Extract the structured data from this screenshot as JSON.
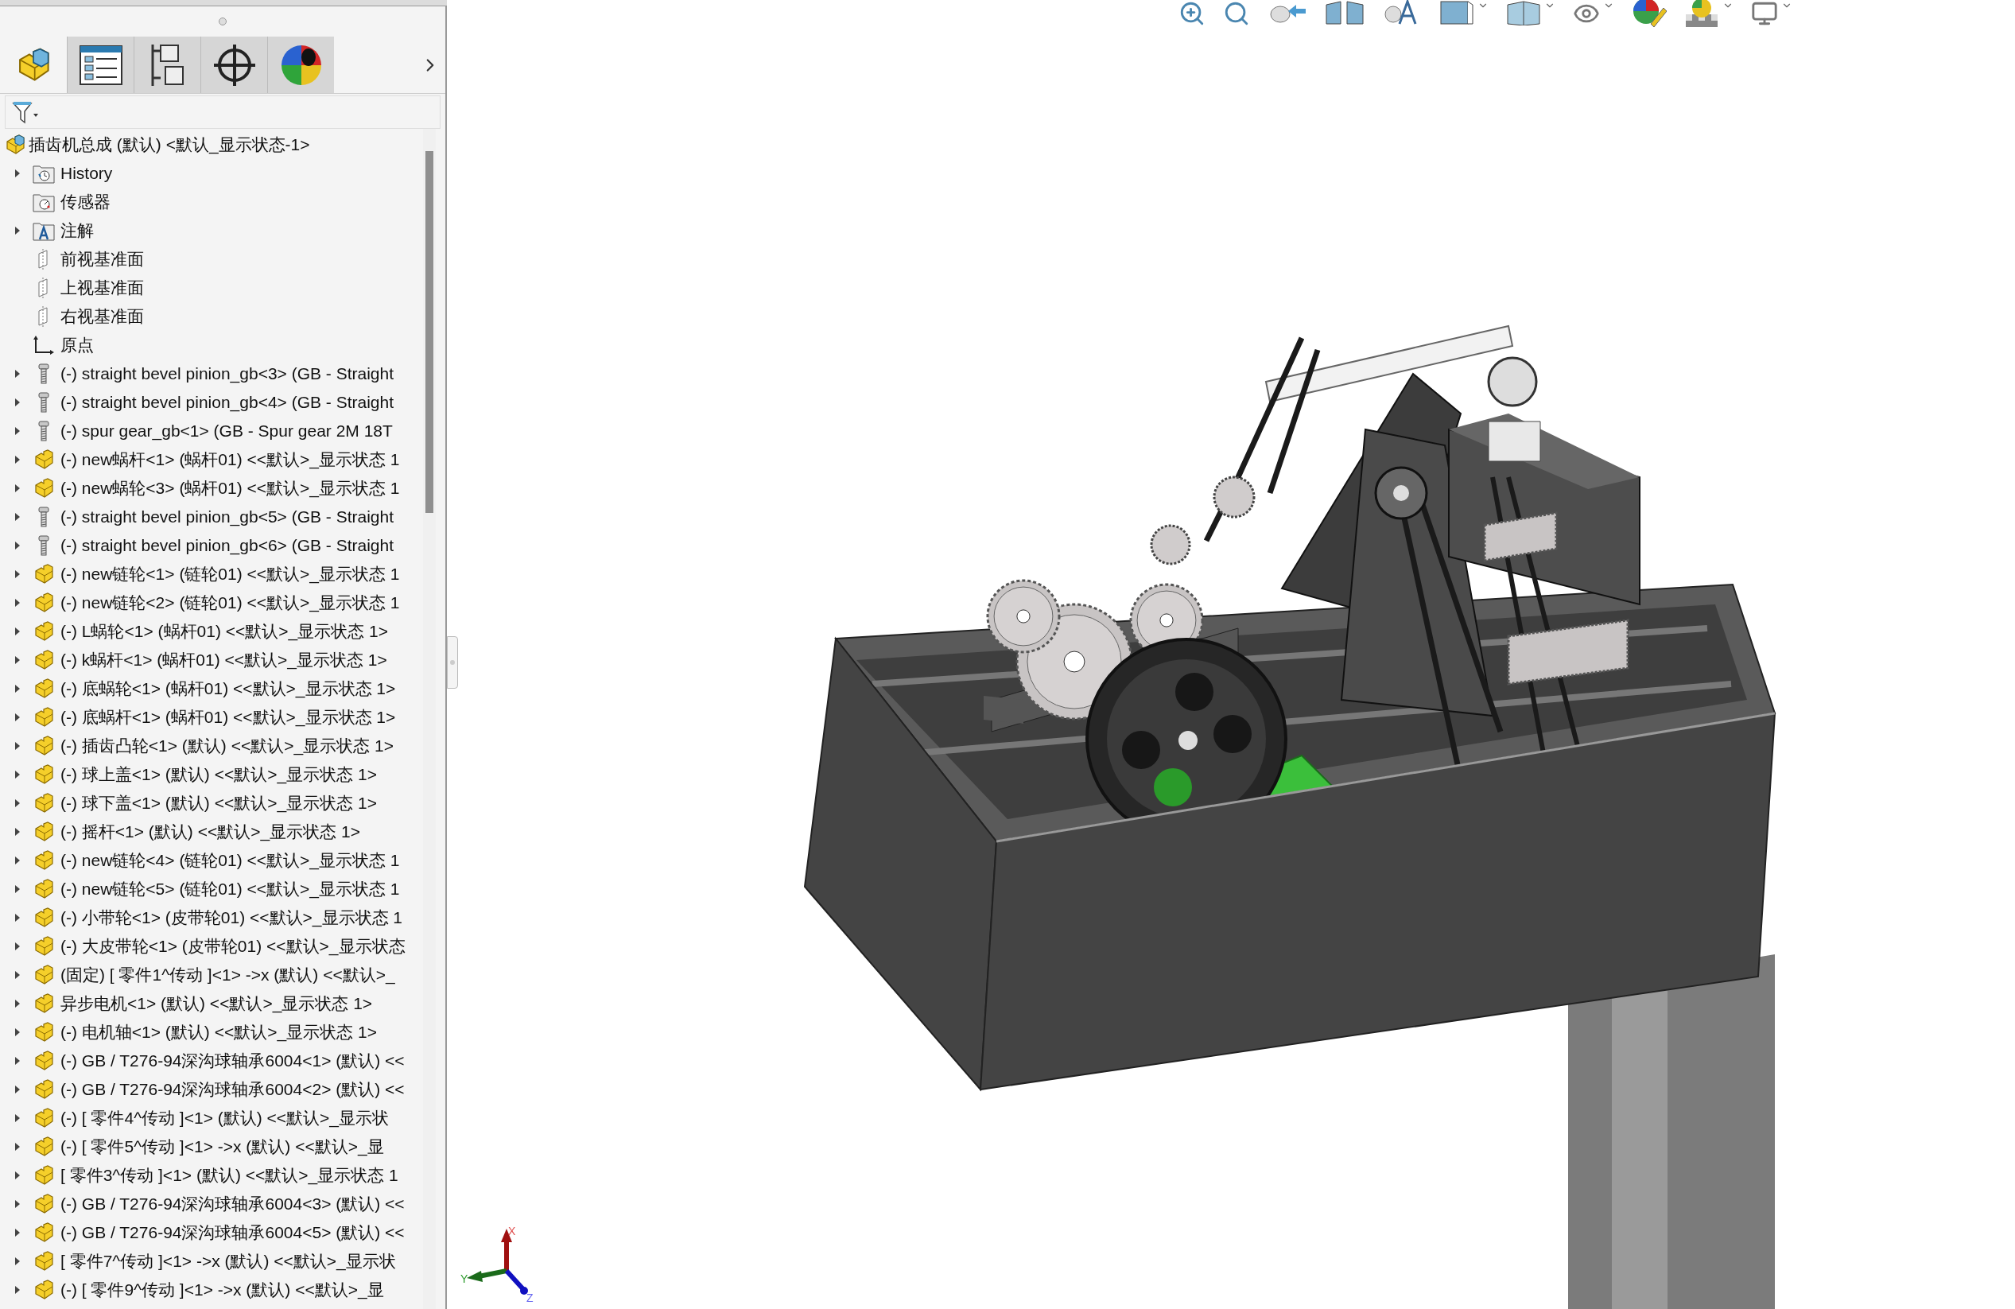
{
  "panel_tabs": [
    {
      "kind": "feature-manager",
      "selected": true
    },
    {
      "kind": "property-manager",
      "selected": false
    },
    {
      "kind": "configuration-manager",
      "selected": false
    },
    {
      "kind": "dimxpert",
      "selected": false
    },
    {
      "kind": "display-manager",
      "selected": false
    }
  ],
  "tree": {
    "label": "插齿机总成 (默认) <默认_显示状态-1>",
    "children": [
      {
        "kind": "history",
        "expandable": true,
        "label": "History"
      },
      {
        "kind": "sensor",
        "expandable": false,
        "label": "传感器"
      },
      {
        "kind": "annotation",
        "expandable": true,
        "label": "注解"
      },
      {
        "kind": "plane",
        "expandable": false,
        "label": "前视基准面"
      },
      {
        "kind": "plane",
        "expandable": false,
        "label": "上视基准面"
      },
      {
        "kind": "plane",
        "expandable": false,
        "label": "右视基准面"
      },
      {
        "kind": "origin",
        "expandable": false,
        "label": "原点"
      },
      {
        "kind": "toolbox",
        "expandable": true,
        "label": "(-) straight bevel pinion_gb<3> (GB - Straight"
      },
      {
        "kind": "toolbox",
        "expandable": true,
        "label": "(-) straight bevel pinion_gb<4> (GB - Straight"
      },
      {
        "kind": "toolbox",
        "expandable": true,
        "label": "(-) spur gear_gb<1> (GB - Spur gear 2M 18T"
      },
      {
        "kind": "component",
        "expandable": true,
        "label": "(-) new蜗杆<1> (蜗杆01) <<默认>_显示状态 1"
      },
      {
        "kind": "component",
        "expandable": true,
        "label": "(-) new蜗轮<3> (蜗杆01) <<默认>_显示状态 1"
      },
      {
        "kind": "toolbox",
        "expandable": true,
        "label": "(-) straight bevel pinion_gb<5> (GB - Straight"
      },
      {
        "kind": "toolbox",
        "expandable": true,
        "label": "(-) straight bevel pinion_gb<6> (GB - Straight"
      },
      {
        "kind": "component",
        "expandable": true,
        "label": "(-) new链轮<1> (链轮01) <<默认>_显示状态 1"
      },
      {
        "kind": "component",
        "expandable": true,
        "label": "(-) new链轮<2> (链轮01) <<默认>_显示状态 1"
      },
      {
        "kind": "component",
        "expandable": true,
        "label": "(-) L蜗轮<1> (蜗杆01) <<默认>_显示状态 1>"
      },
      {
        "kind": "component",
        "expandable": true,
        "label": "(-) k蜗杆<1> (蜗杆01) <<默认>_显示状态 1>"
      },
      {
        "kind": "component",
        "expandable": true,
        "label": "(-) 底蜗轮<1> (蜗杆01) <<默认>_显示状态 1>"
      },
      {
        "kind": "component",
        "expandable": true,
        "label": "(-) 底蜗杆<1> (蜗杆01) <<默认>_显示状态 1>"
      },
      {
        "kind": "component",
        "expandable": true,
        "label": "(-) 插齿凸轮<1> (默认) <<默认>_显示状态 1>"
      },
      {
        "kind": "component",
        "expandable": true,
        "label": "(-) 球上盖<1> (默认) <<默认>_显示状态 1>"
      },
      {
        "kind": "component",
        "expandable": true,
        "label": "(-) 球下盖<1> (默认) <<默认>_显示状态 1>"
      },
      {
        "kind": "component",
        "expandable": true,
        "label": "(-) 摇杆<1> (默认) <<默认>_显示状态 1>"
      },
      {
        "kind": "component",
        "expandable": true,
        "label": "(-) new链轮<4> (链轮01) <<默认>_显示状态 1"
      },
      {
        "kind": "component",
        "expandable": true,
        "label": "(-) new链轮<5> (链轮01) <<默认>_显示状态 1"
      },
      {
        "kind": "component",
        "expandable": true,
        "label": "(-) 小带轮<1> (皮带轮01) <<默认>_显示状态 1"
      },
      {
        "kind": "component",
        "expandable": true,
        "label": "(-) 大皮带轮<1> (皮带轮01) <<默认>_显示状态"
      },
      {
        "kind": "component",
        "expandable": true,
        "label": "(固定) [ 零件1^传动 ]<1> ->x (默认) <<默认>_"
      },
      {
        "kind": "component",
        "expandable": true,
        "label": "异步电机<1> (默认) <<默认>_显示状态 1>"
      },
      {
        "kind": "component",
        "expandable": true,
        "label": "(-) 电机轴<1> (默认) <<默认>_显示状态 1>"
      },
      {
        "kind": "component",
        "expandable": true,
        "label": "(-) GB / T276-94深沟球轴承6004<1> (默认) <<"
      },
      {
        "kind": "component",
        "expandable": true,
        "label": "(-) GB / T276-94深沟球轴承6004<2> (默认) <<"
      },
      {
        "kind": "component",
        "expandable": true,
        "label": "(-) [ 零件4^传动 ]<1> (默认) <<默认>_显示状"
      },
      {
        "kind": "component",
        "expandable": true,
        "label": "(-) [ 零件5^传动 ]<1> ->x (默认) <<默认>_显"
      },
      {
        "kind": "component",
        "expandable": true,
        "label": "[ 零件3^传动 ]<1> (默认) <<默认>_显示状态 1"
      },
      {
        "kind": "component",
        "expandable": true,
        "label": "(-) GB / T276-94深沟球轴承6004<3> (默认) <<"
      },
      {
        "kind": "component",
        "expandable": true,
        "label": "(-) GB / T276-94深沟球轴承6004<5> (默认) <<"
      },
      {
        "kind": "component",
        "expandable": true,
        "label": "[ 零件7^传动 ]<1> ->x (默认) <<默认>_显示状"
      },
      {
        "kind": "component",
        "expandable": true,
        "label": "(-) [ 零件9^传动 ]<1> ->x (默认) <<默认>_显"
      }
    ]
  },
  "viewport": {
    "triad": {
      "x": "X",
      "y": "Y",
      "z": "Z"
    }
  }
}
